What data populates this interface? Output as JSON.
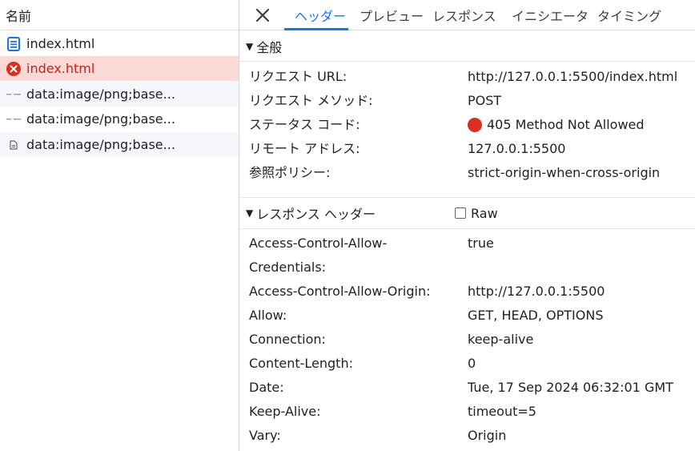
{
  "list": {
    "header": "名前",
    "items": [
      {
        "label": "index.html",
        "icon": "document-icon"
      },
      {
        "label": "index.html",
        "icon": "error-circle-icon",
        "status": "error"
      },
      {
        "label": "data:image/png;base...",
        "icon": "dash-icon"
      },
      {
        "label": "data:image/png;base...",
        "icon": "dash-icon"
      },
      {
        "label": "data:image/png;base...",
        "icon": "small-document-icon"
      }
    ]
  },
  "tabs": [
    "ヘッダー",
    "プレビュー",
    "レスポンス",
    "イニシエータ",
    "タイミング"
  ],
  "active_tab": "ヘッダー",
  "general": {
    "title": "全般",
    "rows": [
      {
        "key": "リクエスト URL:",
        "value": "http://127.0.0.1:5500/index.html"
      },
      {
        "key": "リクエスト メソッド:",
        "value": "POST"
      },
      {
        "key": "ステータス コード:",
        "value": "405 Method Not Allowed"
      },
      {
        "key": "リモート アドレス:",
        "value": "127.0.0.1:5500"
      },
      {
        "key": "参照ポリシー:",
        "value": "strict-origin-when-cross-origin"
      }
    ]
  },
  "response_headers": {
    "title": "レスポンス ヘッダー",
    "raw_label": "Raw",
    "rows": [
      {
        "key": "Access-Control-Allow-Credentials:",
        "value": "true"
      },
      {
        "key": "Access-Control-Allow-Origin:",
        "value": "http://127.0.0.1:5500"
      },
      {
        "key": "Allow:",
        "value": "GET, HEAD, OPTIONS"
      },
      {
        "key": "Connection:",
        "value": "keep-alive"
      },
      {
        "key": "Content-Length:",
        "value": "0"
      },
      {
        "key": "Date:",
        "value": "Tue, 17 Sep 2024 06:32:01 GMT"
      },
      {
        "key": "Keep-Alive:",
        "value": "timeout=5"
      },
      {
        "key": "Vary:",
        "value": "Origin"
      }
    ]
  },
  "colors": {
    "accent": "#1a73e8",
    "error": "#d93025",
    "error_row_bg": "#fad9d6"
  }
}
